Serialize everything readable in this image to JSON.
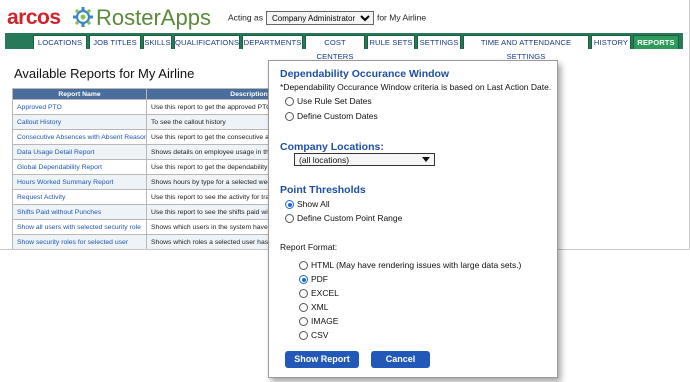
{
  "header": {
    "logo_arcos": "arcos",
    "logo_rosterapps": "RosterApps",
    "acting_prefix": "Acting as",
    "acting_role": "Company Administrator",
    "acting_suffix": "for My Airline"
  },
  "nav": {
    "tabs": [
      "LOCATIONS",
      "JOB TITLES",
      "SKILLS",
      "QUALIFICATIONS",
      "DEPARTMENTS",
      "COST CENTERS",
      "RULE SETS",
      "SETTINGS",
      "TIME AND ATTENDANCE SETTINGS",
      "HISTORY",
      "REPORTS"
    ],
    "active": "REPORTS"
  },
  "reports": {
    "title": "Available Reports for My Airline",
    "col_name": "Report Name",
    "col_desc": "Description",
    "rows": [
      {
        "name": "Approved PTO",
        "desc": "Use this report to get the approved PTO"
      },
      {
        "name": "Callout History",
        "desc": "To see the callout history"
      },
      {
        "name": "Consecutive Absences with Absent Reasons",
        "desc": "Use this report to get the consecutive ab"
      },
      {
        "name": "Data Usage Detail Report",
        "desc": "Shows details on employee usage in the"
      },
      {
        "name": "Global Dependability Report",
        "desc": "Use this report to get the dependability"
      },
      {
        "name": "Hours Worked Summary Report",
        "desc": "Shows hours by type for a selected week"
      },
      {
        "name": "Request Activity",
        "desc": "Use this report to see the activity for tra"
      },
      {
        "name": "Shifts Paid without Punches",
        "desc": "Use this report to see the shifts paid wit"
      },
      {
        "name": "Show all users with selected security role",
        "desc": "Shows which users in the system have t"
      },
      {
        "name": "Show security roles for selected user",
        "desc": "Shows which roles a selected user has in"
      }
    ]
  },
  "modal": {
    "window_title": "Dependability Occurance Window",
    "window_note": "*Dependability Occurance Window criteria is based on Last Action Date.",
    "window_options": [
      "Use Rule Set Dates",
      "Define Custom Dates"
    ],
    "locations_title": "Company Locations:",
    "locations_value": "(all locations)",
    "points_title": "Point Thresholds",
    "points_options": [
      "Show All",
      "Define Custom Point Range"
    ],
    "points_selected": "Show All",
    "format_label": "Report Format:",
    "format_options": [
      "HTML  (May have rendering issues with large data sets.)",
      "PDF",
      "EXCEL",
      "XML",
      "IMAGE",
      "CSV"
    ],
    "format_selected": "PDF",
    "show_button": "Show Report",
    "cancel_button": "Cancel"
  },
  "colors": {
    "brand_red": "#d2232a",
    "brand_green": "#5a8a3a",
    "nav_green": "#28785a",
    "link_blue": "#1f55b4",
    "button_blue": "#2259b8",
    "section_title_blue": "#1f4fa5"
  }
}
